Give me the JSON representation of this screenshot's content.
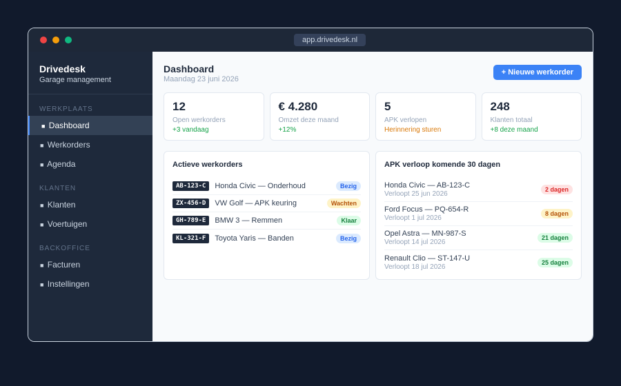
{
  "window": {
    "url": "app.drivedesk.nl",
    "dot_colors": [
      "#ef4444",
      "#f59e0b",
      "#10b981"
    ]
  },
  "sidebar": {
    "brand": "Drivedesk",
    "subtitle": "Garage management",
    "sections": [
      {
        "label": "WERKPLAATS",
        "items": [
          {
            "label": "Dashboard",
            "active": true
          },
          {
            "label": "Werkorders"
          },
          {
            "label": "Agenda"
          }
        ]
      },
      {
        "label": "KLANTEN",
        "items": [
          {
            "label": "Klanten"
          },
          {
            "label": "Voertuigen"
          }
        ]
      },
      {
        "label": "BACKOFFICE",
        "items": [
          {
            "label": "Facturen"
          },
          {
            "label": "Instellingen"
          }
        ]
      }
    ],
    "item_bullet": "■"
  },
  "header": {
    "title": "Dashboard",
    "date": "Maandag 23 juni 2026",
    "new_button": "+ Nieuwe werkorder"
  },
  "stats": [
    {
      "value": "12",
      "label": "Open werkorders",
      "sub": "+3 vandaag",
      "sub_color": "#16a34a"
    },
    {
      "value": "€ 4.280",
      "label": "Omzet deze maand",
      "sub": "+12%",
      "sub_color": "#16a34a"
    },
    {
      "value": "5",
      "label": "APK verlopen",
      "sub": "Herinnering sturen",
      "sub_color": "#d97706"
    },
    {
      "value": "248",
      "label": "Klanten totaal",
      "sub": "+8 deze maand",
      "sub_color": "#16a34a"
    }
  ],
  "work_orders": {
    "title": "Actieve werkorders",
    "rows": [
      {
        "plate": "AB-123-C",
        "desc": "Honda Civic — Onderhoud",
        "status": "Bezig",
        "bg": "#dbeafe",
        "fg": "#2563eb"
      },
      {
        "plate": "ZX-456-D",
        "desc": "VW Golf — APK keuring",
        "status": "Wachten",
        "bg": "#fef3c7",
        "fg": "#b45309"
      },
      {
        "plate": "GH-789-E",
        "desc": "BMW 3 — Remmen",
        "status": "Klaar",
        "bg": "#dcfce7",
        "fg": "#15803d"
      },
      {
        "plate": "KL-321-F",
        "desc": "Toyota Yaris — Banden",
        "status": "Bezig",
        "bg": "#dbeafe",
        "fg": "#2563eb"
      }
    ]
  },
  "apk": {
    "title": "APK verloop komende 30 dagen",
    "rows": [
      {
        "car": "Honda Civic — AB-123-C",
        "date": "Verloopt 25 jun 2026",
        "days": "2 dagen",
        "bg": "#fee2e2",
        "fg": "#dc2626"
      },
      {
        "car": "Ford Focus — PQ-654-R",
        "date": "Verloopt 1 jul 2026",
        "days": "8 dagen",
        "bg": "#fef3c7",
        "fg": "#b45309"
      },
      {
        "car": "Opel Astra — MN-987-S",
        "date": "Verloopt 14 jul 2026",
        "days": "21 dagen",
        "bg": "#dcfce7",
        "fg": "#15803d"
      },
      {
        "car": "Renault Clio — ST-147-U",
        "date": "Verloopt 18 jul 2026",
        "days": "25 dagen",
        "bg": "#dcfce7",
        "fg": "#15803d"
      }
    ]
  }
}
